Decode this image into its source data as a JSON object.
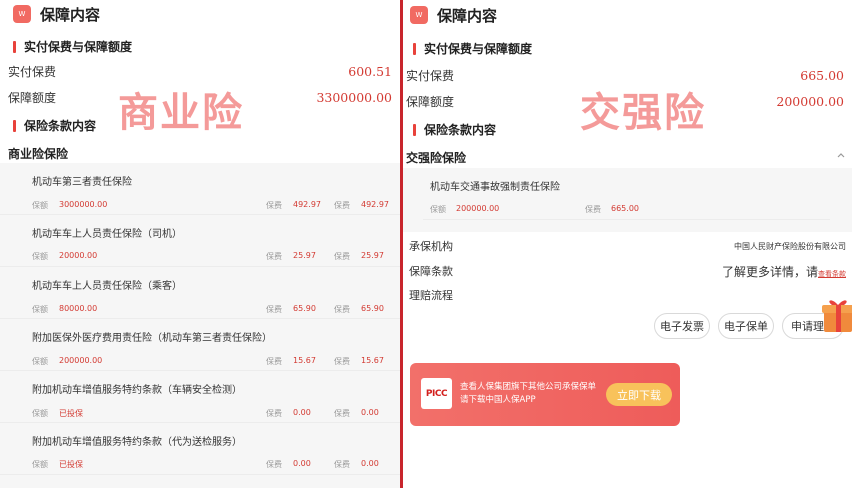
{
  "left": {
    "header": {
      "logo_text": "W",
      "title": "保障内容"
    },
    "section_premium": "实付保费与保障额度",
    "paid_premium": {
      "label": "实付保费",
      "value": "600.51"
    },
    "coverage": {
      "label": "保障额度",
      "value": "3300000.00"
    },
    "section_terms": "保险条款内容",
    "product_title": "商业险保险",
    "stamp": "商业险",
    "items": [
      {
        "name": "机动车第三者责任保险",
        "amount_label": "保额",
        "amount": "3000000.00",
        "premium_label": "保费",
        "premium": "492.97",
        "premium_label2": "保费",
        "premium2": "492.97"
      },
      {
        "name": "机动车车上人员责任保险（司机）",
        "amount_label": "保额",
        "amount": "20000.00",
        "premium_label": "保费",
        "premium": "25.97",
        "premium_label2": "保费",
        "premium2": "25.97"
      },
      {
        "name": "机动车车上人员责任保险（乘客）",
        "amount_label": "保额",
        "amount": "80000.00",
        "premium_label": "保费",
        "premium": "65.90",
        "premium_label2": "保费",
        "premium2": "65.90"
      },
      {
        "name": "附加医保外医疗费用责任险（机动车第三者责任保险）",
        "amount_label": "保额",
        "amount": "200000.00",
        "premium_label": "保费",
        "premium": "15.67",
        "premium_label2": "保费",
        "premium2": "15.67"
      },
      {
        "name": "附加机动车增值服务特约条款（车辆安全检测）",
        "amount_label": "保额",
        "amount": "已投保",
        "premium_label": "保费",
        "premium": "0.00",
        "premium_label2": "保费",
        "premium2": "0.00"
      },
      {
        "name": "附加机动车增值服务特约条款（代为送检服务）",
        "amount_label": "保额",
        "amount": "已投保",
        "premium_label": "保费",
        "premium": "0.00",
        "premium_label2": "保费",
        "premium2": "0.00"
      }
    ]
  },
  "right": {
    "header": {
      "logo_text": "W",
      "title": "保障内容"
    },
    "section_premium": "实付保费与保障额度",
    "paid_premium": {
      "label": "实付保费",
      "value": "665.00"
    },
    "coverage": {
      "label": "保障额度",
      "value": "200000.00"
    },
    "section_terms": "保险条款内容",
    "product_title": "交强险保险",
    "stamp": "交强险",
    "item": {
      "name": "机动车交通事故强制责任保险",
      "amount_label": "保额",
      "amount": "200000.00",
      "premium_label": "保费",
      "premium": "665.00"
    },
    "insurer": {
      "label": "承保机构",
      "value": "中国人民财产保险股份有限公司"
    },
    "terms": {
      "label": "保障条款",
      "text": "了解更多详情，请",
      "link": "查看条款"
    },
    "claims": {
      "label": "理赔流程"
    },
    "buttons": [
      "电子发票",
      "电子保单",
      "申请理赔"
    ],
    "banner": {
      "logo": "PICC",
      "text": "查看人保集团旗下其他公司承保保单请下载中国人保APP",
      "button": "立即下载"
    }
  },
  "colors": {
    "accent": "#e8423b",
    "divider": "#c8252c",
    "stamp": "#f49a99",
    "value": "#d33a32"
  },
  "icons": [
    "logo-icon",
    "chevron-up-icon",
    "gift-icon"
  ]
}
